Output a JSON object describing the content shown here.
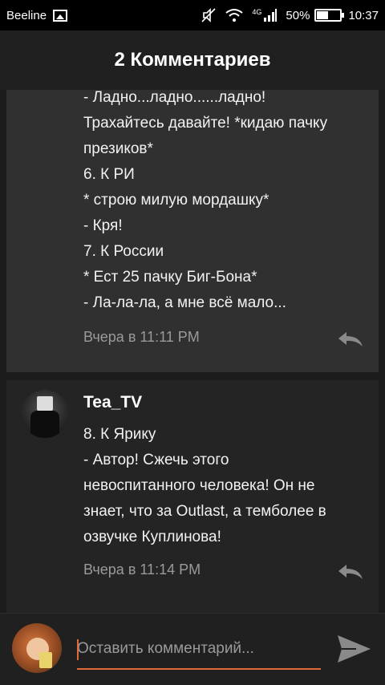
{
  "status_bar": {
    "carrier": "Beeline",
    "network": "4G",
    "battery": "50%",
    "battery_level": 0.5,
    "time": "10:37"
  },
  "header": {
    "title": "2 Комментариев"
  },
  "comments": [
    {
      "author": "",
      "lines": [
        "- Ладно...ладно......ладно!",
        "Трахайтесь давайте! *кидаю пачку",
        "презиков*",
        "6. К РИ",
        "* строю милую мордашку*",
        "- Кря!",
        "7. К России",
        "* Ест 25 пачку Биг-Бона*",
        "- Ла-ла-ла, а мне всё мало..."
      ],
      "timestamp": "Вчера в 11:11 PM"
    },
    {
      "author": "Tea_TV",
      "lines": [
        "8. К Ярику",
        "- Автор! Сжечь этого",
        "невоспитанного человека! Он не",
        "знает, что за Outlast, а темболее в",
        "озвучке Куплинова!"
      ],
      "timestamp": "Вчера в 11:14 PM"
    }
  ],
  "composer": {
    "placeholder": "Оставить комментарий...",
    "value": ""
  },
  "icons": {
    "reply": "reply-icon",
    "send": "send-icon"
  },
  "colors": {
    "accent": "#e06a3c",
    "background": "#202020"
  }
}
